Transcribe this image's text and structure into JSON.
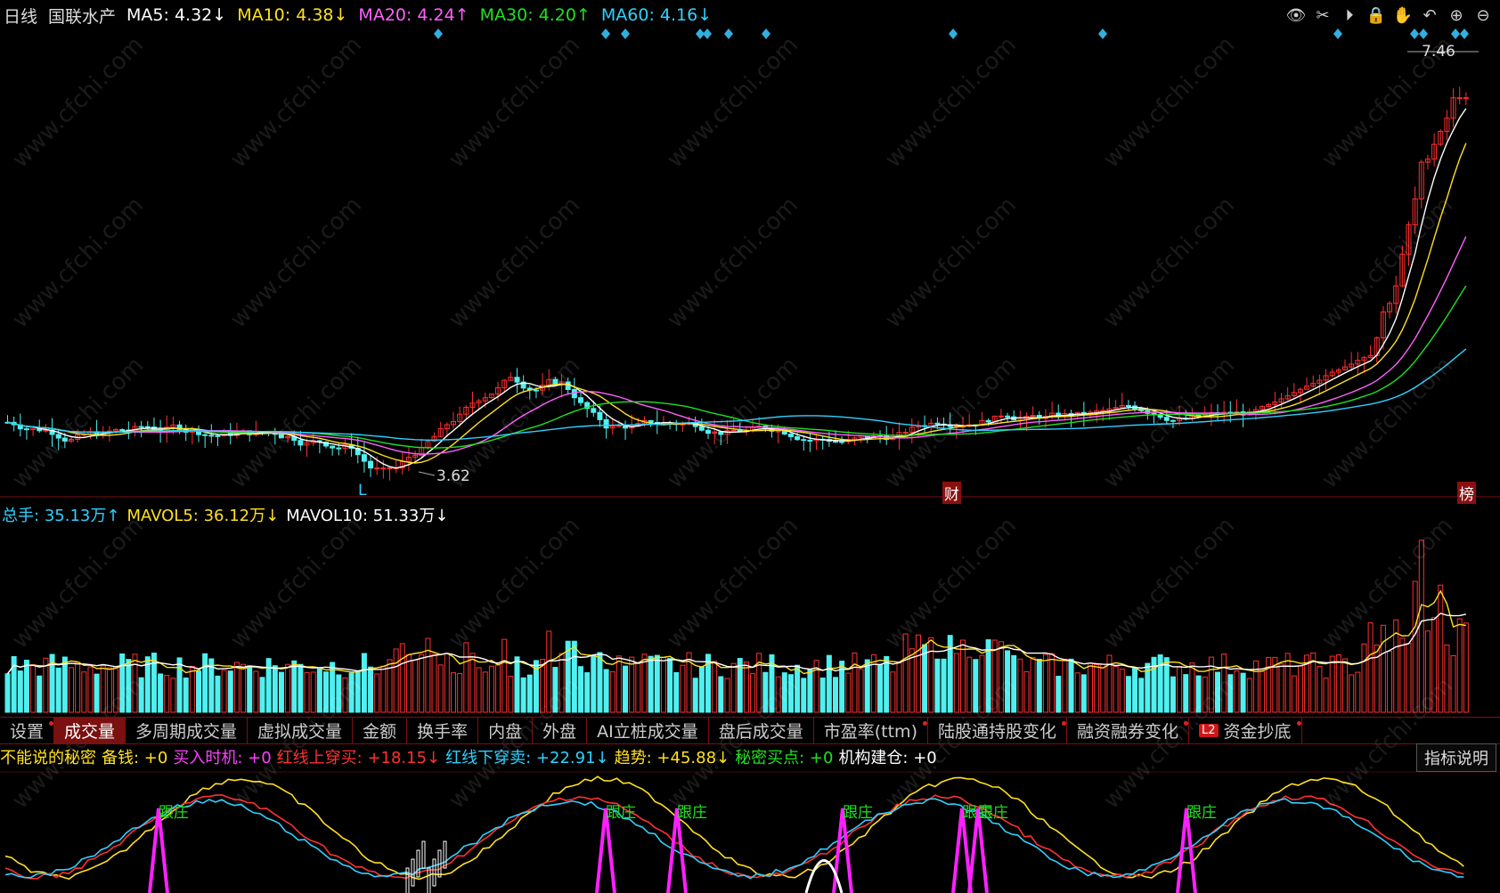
{
  "header": {
    "period": "日线",
    "stock_name": "国联水产",
    "ma": [
      {
        "label": "MA5:",
        "value": "4.32↓",
        "color": "#ffffff"
      },
      {
        "label": "MA10:",
        "value": "4.38↓",
        "color": "#ffe020"
      },
      {
        "label": "MA20:",
        "value": "4.24↑",
        "color": "#ff60ff"
      },
      {
        "label": "MA30:",
        "value": "4.20↑",
        "color": "#20e020"
      },
      {
        "label": "MA60:",
        "value": "4.16↓",
        "color": "#30d0ff"
      }
    ]
  },
  "toolbar_icons": [
    "eye-icon",
    "scissors-icon",
    "play-icon",
    "lock-icon",
    "hand-icon",
    "undo-icon",
    "zoom-in-icon",
    "zoom-out-icon"
  ],
  "price_panel": {
    "high_label": "7.46",
    "low_label": "3.62",
    "markers": {
      "l": "L",
      "cai": "财",
      "bang": "榜"
    }
  },
  "volume_header": {
    "total": {
      "label": "总手:",
      "value": "35.13万↑"
    },
    "mavol5": {
      "label": "MAVOL5:",
      "value": "36.12万↓"
    },
    "mavol10": {
      "label": "MAVOL10:",
      "value": "51.33万↓"
    }
  },
  "tabs": [
    {
      "label": "设置",
      "dot": true
    },
    {
      "label": "成交量",
      "active": true
    },
    {
      "label": "多周期成交量"
    },
    {
      "label": "虚拟成交量"
    },
    {
      "label": "金额"
    },
    {
      "label": "换手率"
    },
    {
      "label": "内盘"
    },
    {
      "label": "外盘"
    },
    {
      "label": "AI立桩成交量"
    },
    {
      "label": "盘后成交量"
    },
    {
      "label": "市盈率(ttm)",
      "dot": true
    },
    {
      "label": "陆股通持股变化",
      "dot": true
    },
    {
      "label": "融资融券变化",
      "dot": true
    },
    {
      "label": "资金抄底",
      "badge": "L2",
      "dot": true
    }
  ],
  "indicator_header": {
    "name": "不能说的秘密",
    "items": [
      {
        "label": "备钱:",
        "value": "+0",
        "color": "#ffe020"
      },
      {
        "label": "买入时机:",
        "value": "+0",
        "color": "#ff40ff"
      },
      {
        "label": "红线上穿买:",
        "value": "+18.15↓",
        "color": "#ff3030"
      },
      {
        "label": "红线下穿卖:",
        "value": "+22.91↓",
        "color": "#30d0ff"
      },
      {
        "label": "趋势:",
        "value": "+45.88↓",
        "color": "#ffe020"
      },
      {
        "label": "秘密买点:",
        "value": "+0",
        "color": "#20e020"
      },
      {
        "label": "机构建仓:",
        "value": "+0",
        "color": "#ffffff"
      }
    ],
    "explain_button": "指标说明",
    "annotation": "跟庄"
  },
  "watermark": "www.cfchi.com",
  "chart_data": {
    "type": "candlestick",
    "price_ylim": [
      3.5,
      7.6
    ],
    "volume_unit": "万",
    "note_values": {
      "max": 7.46,
      "min": 3.62
    }
  }
}
